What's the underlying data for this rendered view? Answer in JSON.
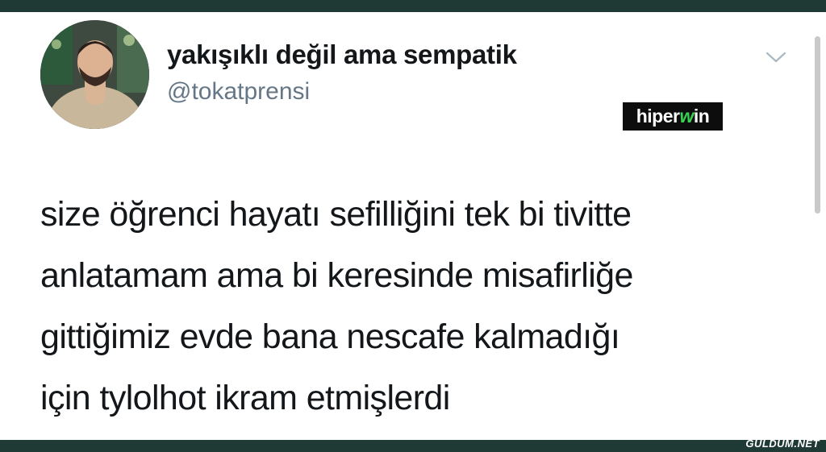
{
  "tweet": {
    "author_name": "yakışıklı değil ama sempatik",
    "author_handle": "@tokatprensi",
    "text_lines": [
      "size öğrenci hayatı sefilliğini tek bi tivitte",
      "anlatamam ama bi keresinde misafirliğe",
      "gittiğimiz evde bana nescafe kalmadığı",
      "için tylolhot ikram etmişlerdi"
    ]
  },
  "overlay_logo": {
    "text_part1": "hiper",
    "text_part2": "w",
    "text_part3": "in"
  },
  "watermark": {
    "text": "GULDUM.NET"
  },
  "icons": {
    "menu": "chevron-down-icon"
  },
  "colors": {
    "frame": "#1f3a34",
    "card": "#ffffff",
    "name": "#14171a",
    "handle": "#657786",
    "logo_accent": "#39d353"
  }
}
